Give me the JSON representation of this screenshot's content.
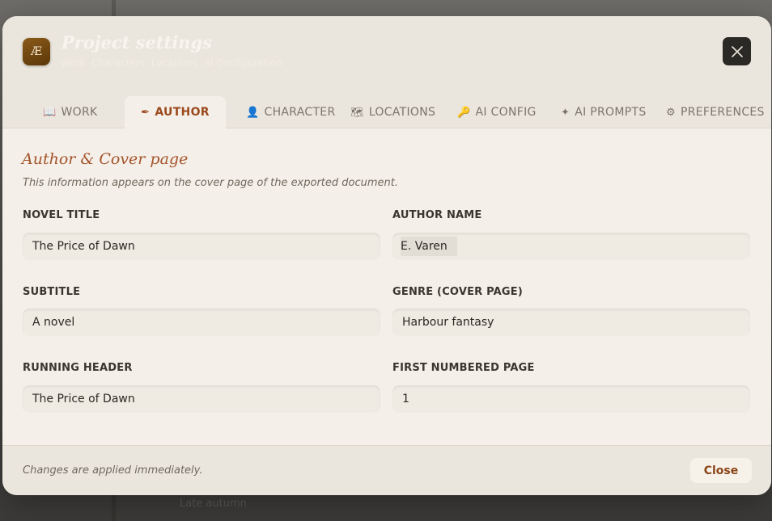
{
  "header": {
    "logo_text": "Æ",
    "title": "Project settings",
    "breadcrumb": [
      "Work",
      "Characters",
      "Locations",
      "AI Configuration"
    ],
    "close_icon": "close-icon"
  },
  "tabs": [
    {
      "icon": "📖",
      "label": "WORK",
      "active": false
    },
    {
      "icon": "✒",
      "label": "AUTHOR",
      "active": true
    },
    {
      "icon": "👤",
      "label": "CHARACTER",
      "active": false
    },
    {
      "icon": "🗺",
      "label": "LOCATIONS",
      "active": false
    },
    {
      "icon": "🔑",
      "label": "AI CONFIG",
      "active": false
    },
    {
      "icon": "✦",
      "label": "AI PROMPTS",
      "active": false
    },
    {
      "icon": "⚙",
      "label": "PREFERENCES",
      "active": false
    }
  ],
  "section": {
    "title": "Author & Cover page",
    "description": "This information appears on the cover page of the exported document."
  },
  "fields": {
    "novel_title": {
      "label": "NOVEL TITLE",
      "value": "The Price of Dawn"
    },
    "author_name": {
      "label": "AUTHOR NAME",
      "value": "E. Varen"
    },
    "subtitle": {
      "label": "SUBTITLE",
      "value": "A novel"
    },
    "genre": {
      "label": "GENRE (COVER PAGE)",
      "value": "Harbour fantasy"
    },
    "running_header": {
      "label": "RUNNING HEADER",
      "value": "The Price of Dawn"
    },
    "first_numbered_page": {
      "label": "FIRST NUMBERED PAGE",
      "value": "1"
    }
  },
  "footer": {
    "note": "Changes are applied immediately.",
    "close_label": "Close"
  },
  "background": {
    "text": "Late autumn"
  },
  "colors": {
    "accent": "#9b4a1e",
    "section_title": "#a5532a",
    "modal_bg": "#f4f0e9",
    "header_bg": "#ebe6dd"
  }
}
